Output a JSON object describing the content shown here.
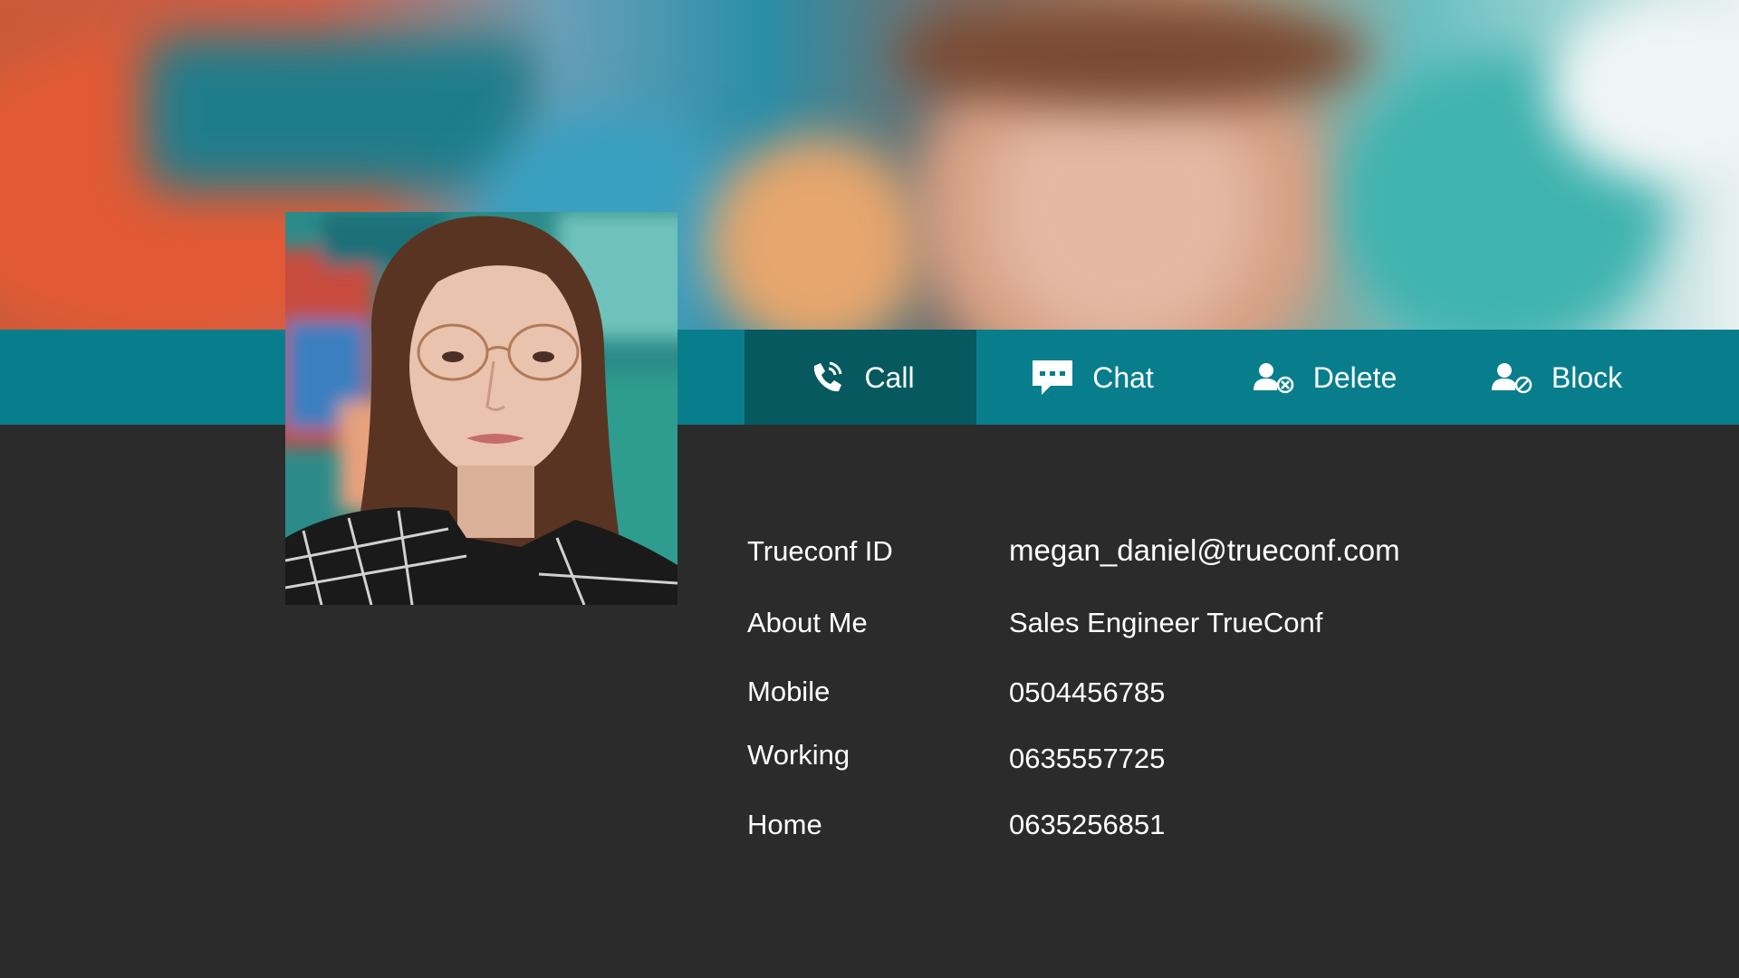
{
  "actions": {
    "call": {
      "label": "Call"
    },
    "chat": {
      "label": "Chat"
    },
    "delete": {
      "label": "Delete"
    },
    "block": {
      "label": "Block"
    }
  },
  "profile": {
    "rows": [
      {
        "label": "Trueconf ID",
        "value": "megan_daniel@trueconf.com"
      },
      {
        "label": "About Me",
        "value": "Sales Engineer TrueConf"
      },
      {
        "label": "Mobile",
        "value": "0504456785"
      },
      {
        "label": "Working",
        "value": "0635557725"
      },
      {
        "label": "Home",
        "value": "0635256851"
      }
    ]
  },
  "colors": {
    "background": "#2b2b2b",
    "actionbar": "#087e8d",
    "active_action": "#06595f",
    "text": "#ffffff"
  },
  "icons": {
    "call": "phone-handset-icon",
    "chat": "chat-bubble-icon",
    "delete": "delete-contact-icon",
    "block": "block-contact-icon"
  }
}
